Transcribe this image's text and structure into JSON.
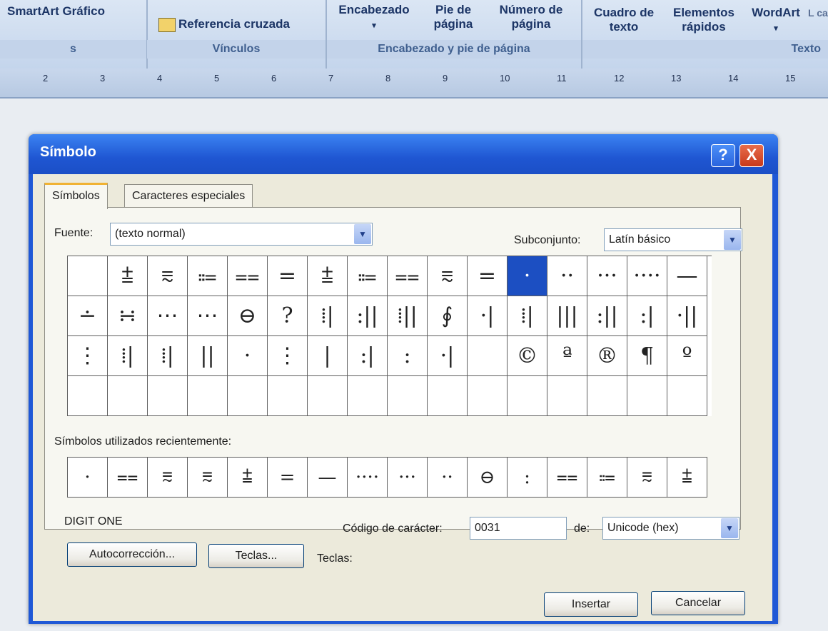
{
  "ribbon": {
    "smartart_label": "SmartArt Gráfico",
    "left_group_footer": "s",
    "cross_ref_label": "Referencia cruzada",
    "links_footer": "Vínculos",
    "header_label": "Encabezado",
    "footer_label": "Pie de página",
    "page_number_label": "Número de página",
    "hf_footer": "Encabezado y pie de página",
    "textbox_label": "Cuadro de texto",
    "quick_parts_label": "Elementos rápidos",
    "wordart_label": "WordArt",
    "dropcap_label": "L cap",
    "text_footer": "Texto"
  },
  "ruler": {
    "ticks": [
      "2",
      "3",
      "4",
      "5",
      "6",
      "7",
      "8",
      "9",
      "10",
      "11",
      "12",
      "13",
      "14",
      "15"
    ]
  },
  "dialog": {
    "title": "Símbolo",
    "help_label": "?",
    "close_label": "X",
    "tabs": [
      "Símbolos",
      "Caracteres especiales"
    ],
    "font_label": "Fuente:",
    "font_value": "(texto normal)",
    "subset_label": "Subconjunto:",
    "subset_value": "Latín básico",
    "grid": [
      [
        "",
        "⩲",
        "⩳",
        "⩴",
        "⩵",
        "=",
        "⩲",
        "⩴",
        "⩵",
        "⩳",
        "=",
        "·",
        "··",
        "···",
        "····",
        "—"
      ],
      [
        "∸",
        "∺",
        "⋯",
        "⋯",
        "⊖",
        "?",
        "⁞|",
        ":||",
        "⁞||",
        "∮",
        "·|",
        "⁞|",
        "|||",
        ":||",
        ":|",
        "·||"
      ],
      [
        "⋮",
        "⁞|",
        "⁞|",
        "||",
        "·",
        "⋮",
        "|",
        ":|",
        ":",
        "·|",
        "",
        "©",
        "ª",
        "®",
        "¶",
        "º"
      ],
      [
        "",
        "",
        "",
        "",
        "",
        "",
        "",
        "",
        "",
        "",
        "",
        "",
        "",
        "",
        "",
        ""
      ]
    ],
    "selected_index": "11",
    "recent_label": "Símbolos utilizados recientemente:",
    "recent": [
      "·",
      "⩵",
      "⩳",
      "⩳",
      "⩲",
      "=",
      "—",
      "····",
      "···",
      "··",
      "⊖",
      ":",
      "⩵",
      "⩴",
      "⩳",
      "⩲"
    ],
    "char_name": "DIGIT ONE",
    "code_label": "Código de carácter:",
    "code_value": "0031",
    "from_label": "de:",
    "from_value": "Unicode (hex)",
    "autocorrect_label": "Autocorrección...",
    "keys_button_label": "Teclas...",
    "keys_text": "Teclas:",
    "insert_label": "Insertar",
    "cancel_label": "Cancelar"
  },
  "colors": {
    "titlebar": "#1f56d2",
    "selection": "#1c4fc2",
    "dialog_bg": "#eceadb"
  }
}
